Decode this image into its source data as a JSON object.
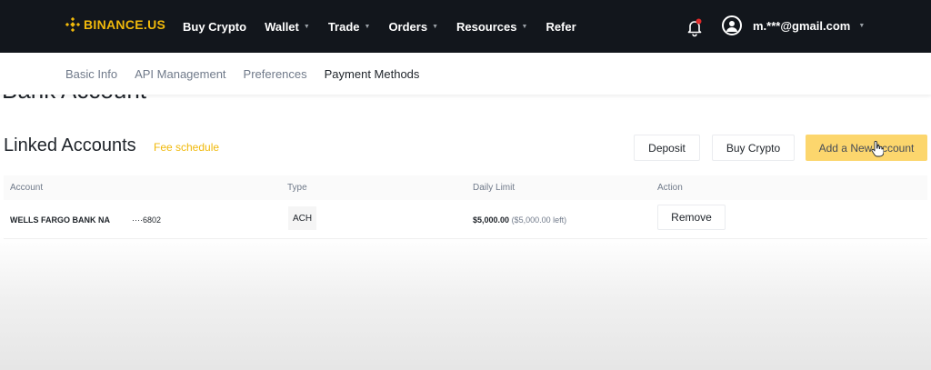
{
  "brand": {
    "name": "BINANCE.US",
    "color": "#f0b90b"
  },
  "nav": {
    "items": [
      {
        "label": "Buy Crypto",
        "dropdown": false
      },
      {
        "label": "Wallet",
        "dropdown": true
      },
      {
        "label": "Trade",
        "dropdown": true
      },
      {
        "label": "Orders",
        "dropdown": true
      },
      {
        "label": "Resources",
        "dropdown": true
      },
      {
        "label": "Refer",
        "dropdown": false
      }
    ],
    "bell_icon": "bell-icon",
    "notification_dot_color": "#e02a2a",
    "user_icon": "user-circle-icon",
    "user_email": "m.***@gmail.com"
  },
  "subnav": {
    "tabs": [
      "Basic Info",
      "API Management",
      "Preferences",
      "Payment Methods"
    ],
    "active": "Payment Methods"
  },
  "page": {
    "partial_heading": "Bank Account",
    "section_title": "Linked Accounts",
    "fee_link": "Fee schedule",
    "buttons": {
      "deposit": "Deposit",
      "buy_crypto": "Buy Crypto",
      "add_account": "Add a New Account"
    }
  },
  "table": {
    "headers": {
      "account": "Account",
      "type": "Type",
      "daily_limit": "Daily Limit",
      "action": "Action"
    },
    "rows": [
      {
        "bank": "WELLS FARGO BANK NA",
        "account_number": "····6802",
        "type": "ACH",
        "limit": "$5,000.00",
        "limit_left": "($5,000.00 left)",
        "action": "Remove"
      }
    ]
  }
}
